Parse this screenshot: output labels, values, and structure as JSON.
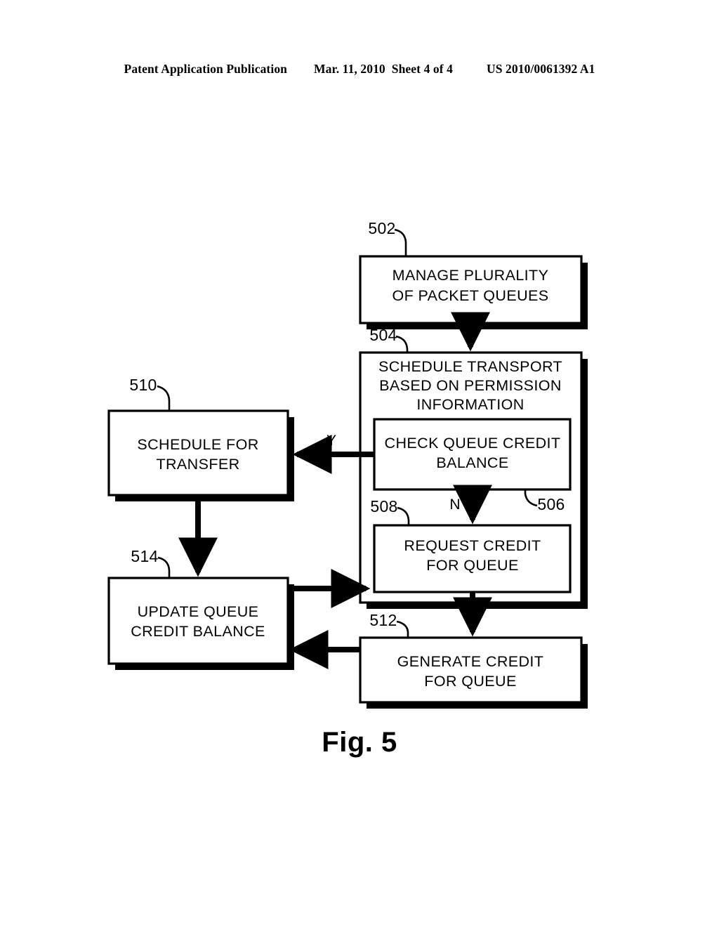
{
  "header": {
    "publication": "Patent Application Publication",
    "date": "Mar. 11, 2010",
    "sheet": "Sheet 4 of 4",
    "patent_number": "US 2010/0061392 A1"
  },
  "figure": {
    "caption": "Fig. 5",
    "colors": {
      "stroke": "#000000",
      "fill": "#ffffff",
      "shadow": "#000000"
    },
    "boxes": {
      "b502": {
        "ref": "502",
        "line1": "MANAGE PLURALITY",
        "line2": "OF PACKET QUEUES"
      },
      "b504": {
        "ref": "504",
        "line1": "SCHEDULE TRANSPORT",
        "line2": "BASED ON PERMISSION",
        "line3": "INFORMATION"
      },
      "b506": {
        "ref": "506",
        "line1": "CHECK QUEUE CREDIT",
        "line2": "BALANCE"
      },
      "b508": {
        "ref": "508",
        "line1": "REQUEST CREDIT",
        "line2": "FOR QUEUE"
      },
      "b510": {
        "ref": "510",
        "line1": "SCHEDULE FOR",
        "line2": "TRANSFER"
      },
      "b512": {
        "ref": "512",
        "line1": "GENERATE  CREDIT",
        "line2": "FOR QUEUE"
      },
      "b514": {
        "ref": "514",
        "line1": "UPDATE QUEUE",
        "line2": "CREDIT BALANCE"
      }
    },
    "branch_labels": {
      "yes": "Y",
      "no": "N"
    }
  }
}
